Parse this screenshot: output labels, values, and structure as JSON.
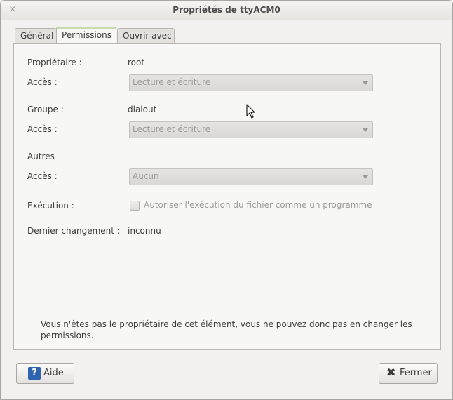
{
  "window": {
    "title": "Propriétés de ttyACM0",
    "close_glyph": "×"
  },
  "tabs": [
    {
      "label": "Général",
      "active": false
    },
    {
      "label": "Permissions",
      "active": true
    },
    {
      "label": "Ouvrir avec",
      "active": false
    }
  ],
  "permissions": {
    "owner_label": "Propriétaire :",
    "owner_value": "root",
    "owner_access_label": "Accès :",
    "owner_access_value": "Lecture et écriture",
    "group_label": "Groupe :",
    "group_value": "dialout",
    "group_access_label": "Accès :",
    "group_access_value": "Lecture et écriture",
    "others_label": "Autres",
    "others_access_label": "Accès :",
    "others_access_value": "Aucun",
    "exec_label": "Exécution :",
    "exec_checkbox_label": "Autoriser l'exécution du fichier comme un programme",
    "exec_checked": false,
    "last_change_label": "Dernier changement :",
    "last_change_value": "inconnu",
    "notice": "Vous n'êtes pas le propriétaire de cet élément, vous ne pouvez donc pas en changer les permissions."
  },
  "buttons": {
    "help_label": "Aide",
    "help_icon": "question-icon",
    "close_label": "Fermer",
    "close_icon": "close-icon"
  },
  "colors": {
    "accent_tab": "#c8dcab",
    "help_icon_bg": "#2e63b0"
  }
}
